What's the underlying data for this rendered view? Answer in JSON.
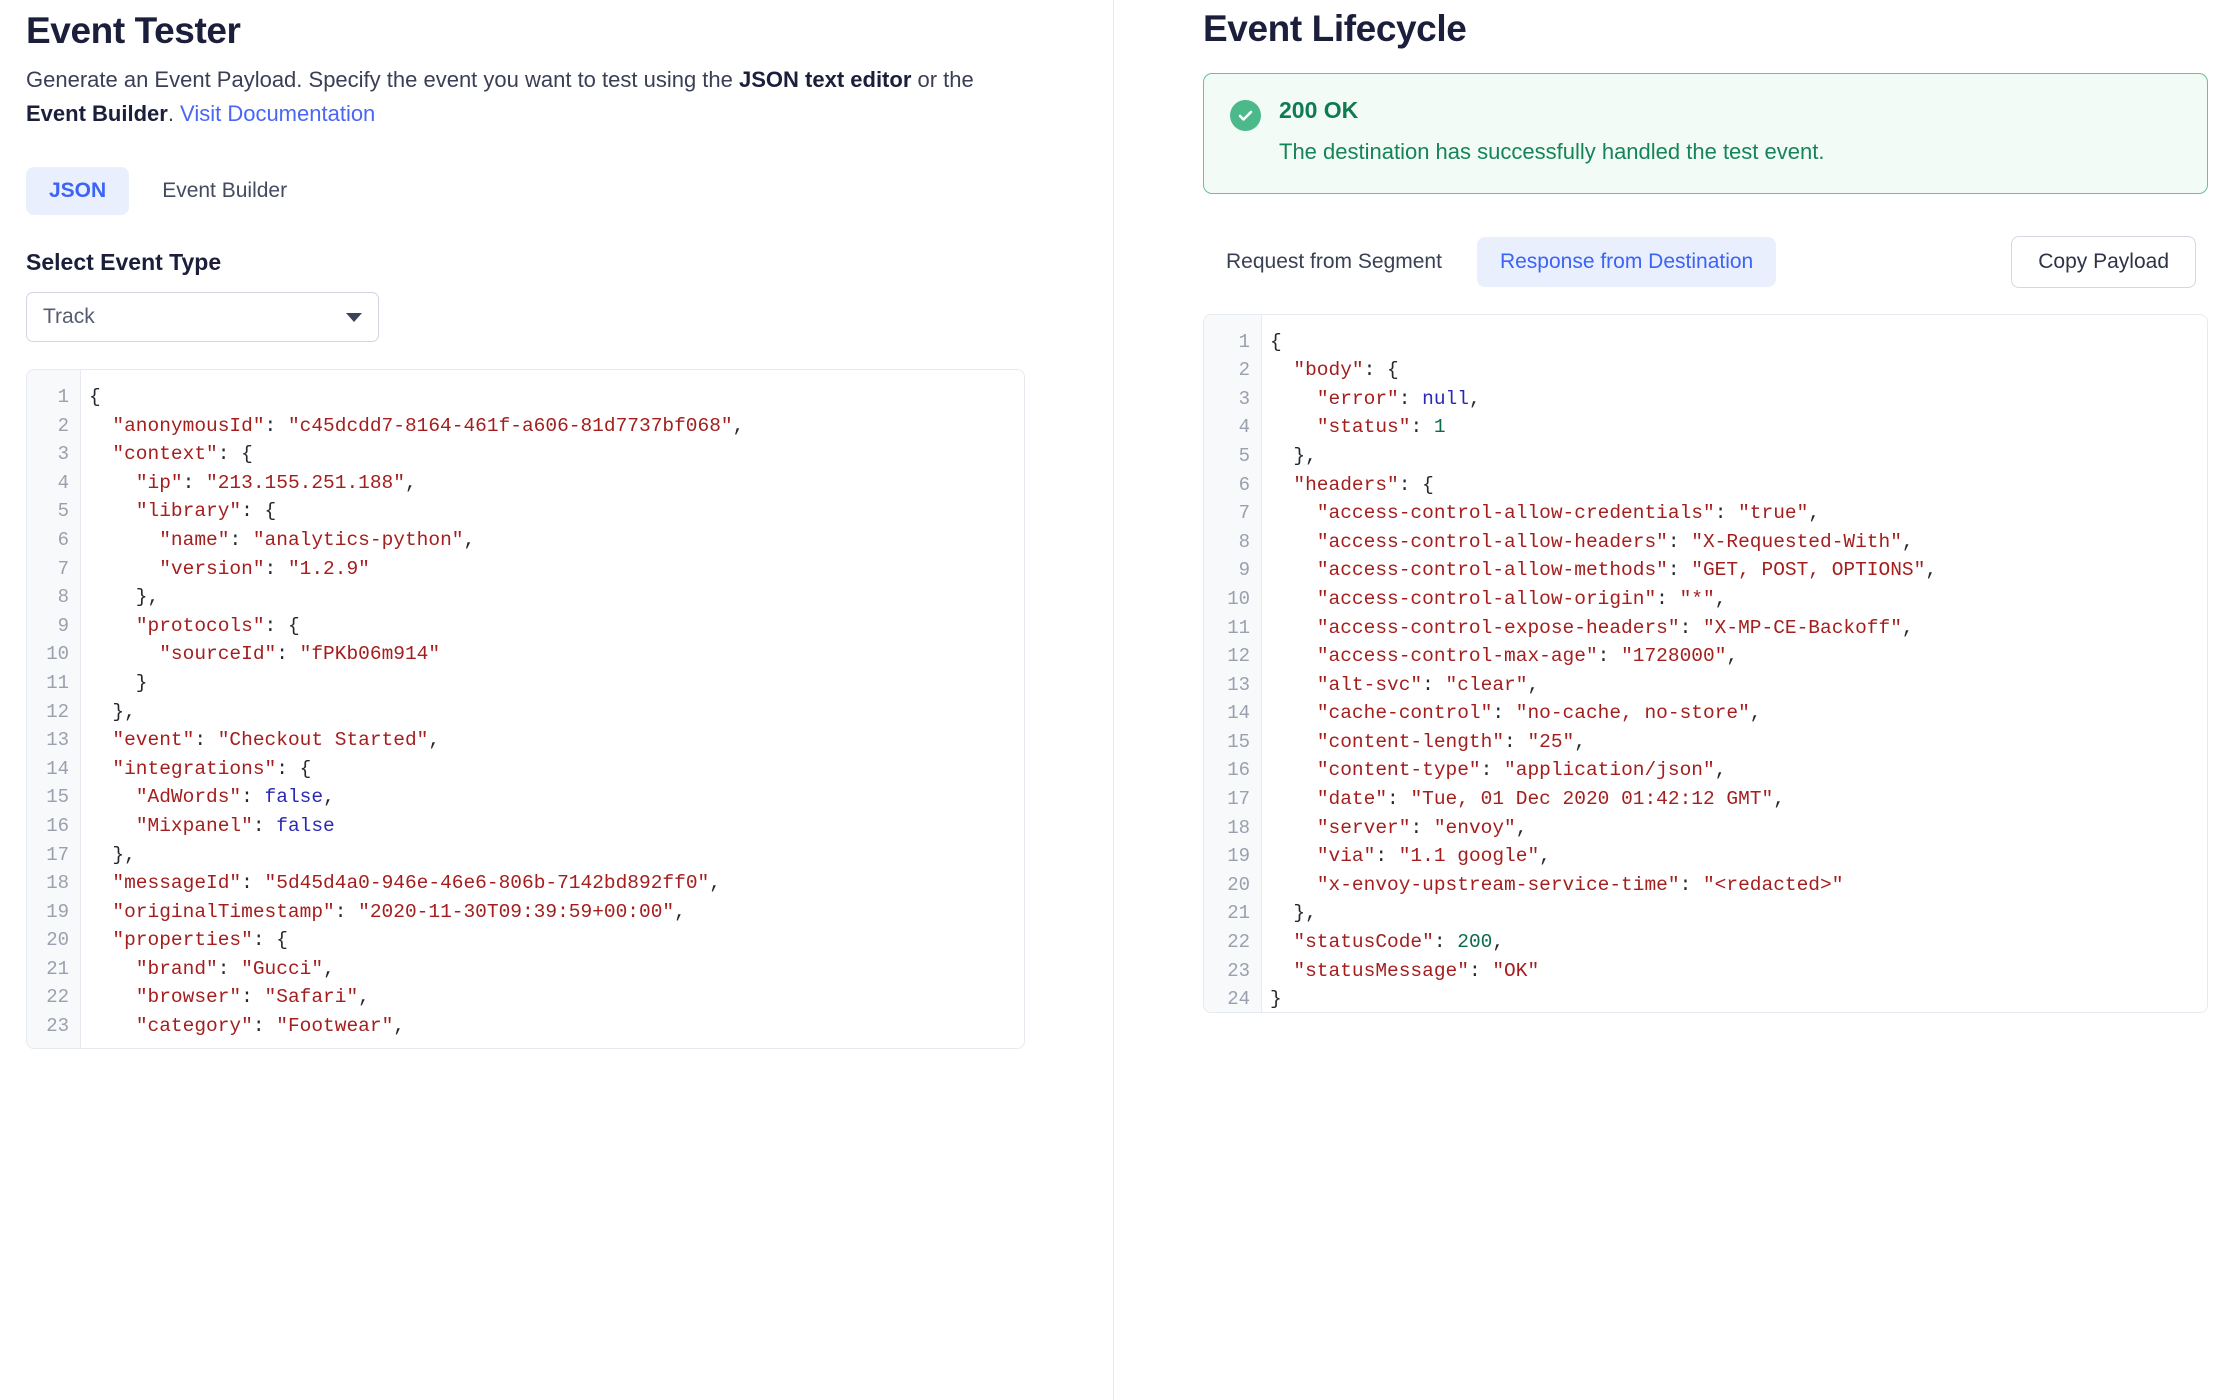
{
  "left": {
    "title": "Event Tester",
    "description_part1": "Generate an Event Payload. Specify the event you want to test using the ",
    "description_bold1": "JSON text editor",
    "description_part2": " or the ",
    "description_bold2": "Event Builder",
    "description_part3": ". ",
    "doc_link": "Visit Documentation",
    "tabs": [
      {
        "label": "JSON",
        "active": true
      },
      {
        "label": "Event Builder",
        "active": false
      }
    ],
    "select_label": "Select Event Type",
    "select_value": "Track",
    "select_icon": "chevron-down-icon",
    "editor_lines": [
      {
        "n": "1",
        "tokens": [
          {
            "t": "pun",
            "v": "{"
          }
        ]
      },
      {
        "n": "2",
        "tokens": [
          {
            "t": "pun",
            "v": "  "
          },
          {
            "t": "key",
            "v": "\"anonymousId\""
          },
          {
            "t": "pun",
            "v": ": "
          },
          {
            "t": "str",
            "v": "\"c45dcdd7-8164-461f-a606-81d7737bf068\""
          },
          {
            "t": "pun",
            "v": ","
          }
        ]
      },
      {
        "n": "3",
        "tokens": [
          {
            "t": "pun",
            "v": "  "
          },
          {
            "t": "key",
            "v": "\"context\""
          },
          {
            "t": "pun",
            "v": ": {"
          }
        ]
      },
      {
        "n": "4",
        "tokens": [
          {
            "t": "pun",
            "v": "    "
          },
          {
            "t": "key",
            "v": "\"ip\""
          },
          {
            "t": "pun",
            "v": ": "
          },
          {
            "t": "str",
            "v": "\"213.155.251.188\""
          },
          {
            "t": "pun",
            "v": ","
          }
        ]
      },
      {
        "n": "5",
        "tokens": [
          {
            "t": "pun",
            "v": "    "
          },
          {
            "t": "key",
            "v": "\"library\""
          },
          {
            "t": "pun",
            "v": ": {"
          }
        ]
      },
      {
        "n": "6",
        "tokens": [
          {
            "t": "pun",
            "v": "      "
          },
          {
            "t": "key",
            "v": "\"name\""
          },
          {
            "t": "pun",
            "v": ": "
          },
          {
            "t": "str",
            "v": "\"analytics-python\""
          },
          {
            "t": "pun",
            "v": ","
          }
        ]
      },
      {
        "n": "7",
        "tokens": [
          {
            "t": "pun",
            "v": "      "
          },
          {
            "t": "key",
            "v": "\"version\""
          },
          {
            "t": "pun",
            "v": ": "
          },
          {
            "t": "str",
            "v": "\"1.2.9\""
          }
        ]
      },
      {
        "n": "8",
        "tokens": [
          {
            "t": "pun",
            "v": "    },"
          }
        ]
      },
      {
        "n": "9",
        "tokens": [
          {
            "t": "pun",
            "v": "    "
          },
          {
            "t": "key",
            "v": "\"protocols\""
          },
          {
            "t": "pun",
            "v": ": {"
          }
        ]
      },
      {
        "n": "10",
        "tokens": [
          {
            "t": "pun",
            "v": "      "
          },
          {
            "t": "key",
            "v": "\"sourceId\""
          },
          {
            "t": "pun",
            "v": ": "
          },
          {
            "t": "str",
            "v": "\"fPKb06m914\""
          }
        ]
      },
      {
        "n": "11",
        "tokens": [
          {
            "t": "pun",
            "v": "    }"
          }
        ]
      },
      {
        "n": "12",
        "tokens": [
          {
            "t": "pun",
            "v": "  },"
          }
        ]
      },
      {
        "n": "13",
        "tokens": [
          {
            "t": "pun",
            "v": "  "
          },
          {
            "t": "key",
            "v": "\"event\""
          },
          {
            "t": "pun",
            "v": ": "
          },
          {
            "t": "str",
            "v": "\"Checkout Started\""
          },
          {
            "t": "pun",
            "v": ","
          }
        ]
      },
      {
        "n": "14",
        "tokens": [
          {
            "t": "pun",
            "v": "  "
          },
          {
            "t": "key",
            "v": "\"integrations\""
          },
          {
            "t": "pun",
            "v": ": {"
          }
        ]
      },
      {
        "n": "15",
        "tokens": [
          {
            "t": "pun",
            "v": "    "
          },
          {
            "t": "key",
            "v": "\"AdWords\""
          },
          {
            "t": "pun",
            "v": ": "
          },
          {
            "t": "bool",
            "v": "false"
          },
          {
            "t": "pun",
            "v": ","
          }
        ]
      },
      {
        "n": "16",
        "tokens": [
          {
            "t": "pun",
            "v": "    "
          },
          {
            "t": "key",
            "v": "\"Mixpanel\""
          },
          {
            "t": "pun",
            "v": ": "
          },
          {
            "t": "bool",
            "v": "false"
          }
        ]
      },
      {
        "n": "17",
        "tokens": [
          {
            "t": "pun",
            "v": "  },"
          }
        ]
      },
      {
        "n": "18",
        "tokens": [
          {
            "t": "pun",
            "v": "  "
          },
          {
            "t": "key",
            "v": "\"messageId\""
          },
          {
            "t": "pun",
            "v": ": "
          },
          {
            "t": "str",
            "v": "\"5d45d4a0-946e-46e6-806b-7142bd892ff0\""
          },
          {
            "t": "pun",
            "v": ","
          }
        ]
      },
      {
        "n": "19",
        "tokens": [
          {
            "t": "pun",
            "v": "  "
          },
          {
            "t": "key",
            "v": "\"originalTimestamp\""
          },
          {
            "t": "pun",
            "v": ": "
          },
          {
            "t": "str",
            "v": "\"2020-11-30T09:39:59+00:00\""
          },
          {
            "t": "pun",
            "v": ","
          }
        ]
      },
      {
        "n": "20",
        "tokens": [
          {
            "t": "pun",
            "v": "  "
          },
          {
            "t": "key",
            "v": "\"properties\""
          },
          {
            "t": "pun",
            "v": ": {"
          }
        ]
      },
      {
        "n": "21",
        "tokens": [
          {
            "t": "pun",
            "v": "    "
          },
          {
            "t": "key",
            "v": "\"brand\""
          },
          {
            "t": "pun",
            "v": ": "
          },
          {
            "t": "str",
            "v": "\"Gucci\""
          },
          {
            "t": "pun",
            "v": ","
          }
        ]
      },
      {
        "n": "22",
        "tokens": [
          {
            "t": "pun",
            "v": "    "
          },
          {
            "t": "key",
            "v": "\"browser\""
          },
          {
            "t": "pun",
            "v": ": "
          },
          {
            "t": "str",
            "v": "\"Safari\""
          },
          {
            "t": "pun",
            "v": ","
          }
        ]
      },
      {
        "n": "23",
        "tokens": [
          {
            "t": "pun",
            "v": "    "
          },
          {
            "t": "key",
            "v": "\"category\""
          },
          {
            "t": "pun",
            "v": ": "
          },
          {
            "t": "str",
            "v": "\"Footwear\""
          },
          {
            "t": "pun",
            "v": ","
          }
        ]
      }
    ]
  },
  "right": {
    "title": "Event Lifecycle",
    "alert": {
      "icon": "check-circle-icon",
      "status": "200 OK",
      "message": "The destination has successfully handled the test event.",
      "border_color": "#64c39a",
      "background_color": "#f3fbf7",
      "icon_color": "#4bb98a"
    },
    "tabs": [
      {
        "label": "Request from Segment",
        "active": false
      },
      {
        "label": "Response from Destination",
        "active": true
      }
    ],
    "copy_button": "Copy Payload",
    "editor_lines": [
      {
        "n": "1",
        "tokens": [
          {
            "t": "pun",
            "v": "{"
          }
        ]
      },
      {
        "n": "2",
        "tokens": [
          {
            "t": "pun",
            "v": "  "
          },
          {
            "t": "key",
            "v": "\"body\""
          },
          {
            "t": "pun",
            "v": ": {"
          }
        ]
      },
      {
        "n": "3",
        "tokens": [
          {
            "t": "pun",
            "v": "    "
          },
          {
            "t": "key",
            "v": "\"error\""
          },
          {
            "t": "pun",
            "v": ": "
          },
          {
            "t": "null",
            "v": "null"
          },
          {
            "t": "pun",
            "v": ","
          }
        ]
      },
      {
        "n": "4",
        "tokens": [
          {
            "t": "pun",
            "v": "    "
          },
          {
            "t": "key",
            "v": "\"status\""
          },
          {
            "t": "pun",
            "v": ": "
          },
          {
            "t": "num",
            "v": "1"
          }
        ]
      },
      {
        "n": "5",
        "tokens": [
          {
            "t": "pun",
            "v": "  },"
          }
        ]
      },
      {
        "n": "6",
        "tokens": [
          {
            "t": "pun",
            "v": "  "
          },
          {
            "t": "key",
            "v": "\"headers\""
          },
          {
            "t": "pun",
            "v": ": {"
          }
        ]
      },
      {
        "n": "7",
        "tokens": [
          {
            "t": "pun",
            "v": "    "
          },
          {
            "t": "key",
            "v": "\"access-control-allow-credentials\""
          },
          {
            "t": "pun",
            "v": ": "
          },
          {
            "t": "str",
            "v": "\"true\""
          },
          {
            "t": "pun",
            "v": ","
          }
        ]
      },
      {
        "n": "8",
        "tokens": [
          {
            "t": "pun",
            "v": "    "
          },
          {
            "t": "key",
            "v": "\"access-control-allow-headers\""
          },
          {
            "t": "pun",
            "v": ": "
          },
          {
            "t": "str",
            "v": "\"X-Requested-With\""
          },
          {
            "t": "pun",
            "v": ","
          }
        ]
      },
      {
        "n": "9",
        "tokens": [
          {
            "t": "pun",
            "v": "    "
          },
          {
            "t": "key",
            "v": "\"access-control-allow-methods\""
          },
          {
            "t": "pun",
            "v": ": "
          },
          {
            "t": "str",
            "v": "\"GET, POST, OPTIONS\""
          },
          {
            "t": "pun",
            "v": ","
          }
        ]
      },
      {
        "n": "10",
        "tokens": [
          {
            "t": "pun",
            "v": "    "
          },
          {
            "t": "key",
            "v": "\"access-control-allow-origin\""
          },
          {
            "t": "pun",
            "v": ": "
          },
          {
            "t": "str",
            "v": "\"*\""
          },
          {
            "t": "pun",
            "v": ","
          }
        ]
      },
      {
        "n": "11",
        "tokens": [
          {
            "t": "pun",
            "v": "    "
          },
          {
            "t": "key",
            "v": "\"access-control-expose-headers\""
          },
          {
            "t": "pun",
            "v": ": "
          },
          {
            "t": "str",
            "v": "\"X-MP-CE-Backoff\""
          },
          {
            "t": "pun",
            "v": ","
          }
        ]
      },
      {
        "n": "12",
        "tokens": [
          {
            "t": "pun",
            "v": "    "
          },
          {
            "t": "key",
            "v": "\"access-control-max-age\""
          },
          {
            "t": "pun",
            "v": ": "
          },
          {
            "t": "str",
            "v": "\"1728000\""
          },
          {
            "t": "pun",
            "v": ","
          }
        ]
      },
      {
        "n": "13",
        "tokens": [
          {
            "t": "pun",
            "v": "    "
          },
          {
            "t": "key",
            "v": "\"alt-svc\""
          },
          {
            "t": "pun",
            "v": ": "
          },
          {
            "t": "str",
            "v": "\"clear\""
          },
          {
            "t": "pun",
            "v": ","
          }
        ]
      },
      {
        "n": "14",
        "tokens": [
          {
            "t": "pun",
            "v": "    "
          },
          {
            "t": "key",
            "v": "\"cache-control\""
          },
          {
            "t": "pun",
            "v": ": "
          },
          {
            "t": "str",
            "v": "\"no-cache, no-store\""
          },
          {
            "t": "pun",
            "v": ","
          }
        ]
      },
      {
        "n": "15",
        "tokens": [
          {
            "t": "pun",
            "v": "    "
          },
          {
            "t": "key",
            "v": "\"content-length\""
          },
          {
            "t": "pun",
            "v": ": "
          },
          {
            "t": "str",
            "v": "\"25\""
          },
          {
            "t": "pun",
            "v": ","
          }
        ]
      },
      {
        "n": "16",
        "tokens": [
          {
            "t": "pun",
            "v": "    "
          },
          {
            "t": "key",
            "v": "\"content-type\""
          },
          {
            "t": "pun",
            "v": ": "
          },
          {
            "t": "str",
            "v": "\"application/json\""
          },
          {
            "t": "pun",
            "v": ","
          }
        ]
      },
      {
        "n": "17",
        "tokens": [
          {
            "t": "pun",
            "v": "    "
          },
          {
            "t": "key",
            "v": "\"date\""
          },
          {
            "t": "pun",
            "v": ": "
          },
          {
            "t": "str",
            "v": "\"Tue, 01 Dec 2020 01:42:12 GMT\""
          },
          {
            "t": "pun",
            "v": ","
          }
        ]
      },
      {
        "n": "18",
        "tokens": [
          {
            "t": "pun",
            "v": "    "
          },
          {
            "t": "key",
            "v": "\"server\""
          },
          {
            "t": "pun",
            "v": ": "
          },
          {
            "t": "str",
            "v": "\"envoy\""
          },
          {
            "t": "pun",
            "v": ","
          }
        ]
      },
      {
        "n": "19",
        "tokens": [
          {
            "t": "pun",
            "v": "    "
          },
          {
            "t": "key",
            "v": "\"via\""
          },
          {
            "t": "pun",
            "v": ": "
          },
          {
            "t": "str",
            "v": "\"1.1 google\""
          },
          {
            "t": "pun",
            "v": ","
          }
        ]
      },
      {
        "n": "20",
        "tokens": [
          {
            "t": "pun",
            "v": "    "
          },
          {
            "t": "key",
            "v": "\"x-envoy-upstream-service-time\""
          },
          {
            "t": "pun",
            "v": ": "
          },
          {
            "t": "str",
            "v": "\"<redacted>\""
          }
        ]
      },
      {
        "n": "21",
        "tokens": [
          {
            "t": "pun",
            "v": "  },"
          }
        ]
      },
      {
        "n": "22",
        "tokens": [
          {
            "t": "pun",
            "v": "  "
          },
          {
            "t": "key",
            "v": "\"statusCode\""
          },
          {
            "t": "pun",
            "v": ": "
          },
          {
            "t": "num",
            "v": "200"
          },
          {
            "t": "pun",
            "v": ","
          }
        ]
      },
      {
        "n": "23",
        "tokens": [
          {
            "t": "pun",
            "v": "  "
          },
          {
            "t": "key",
            "v": "\"statusMessage\""
          },
          {
            "t": "pun",
            "v": ": "
          },
          {
            "t": "str",
            "v": "\"OK\""
          }
        ]
      },
      {
        "n": "24",
        "tokens": [
          {
            "t": "pun",
            "v": "}"
          }
        ]
      }
    ]
  },
  "colors": {
    "accent_blue": "#3b63f6",
    "link_blue": "#4a66f5",
    "success_green": "#4bb98a",
    "heading": "#1b1f3b"
  }
}
